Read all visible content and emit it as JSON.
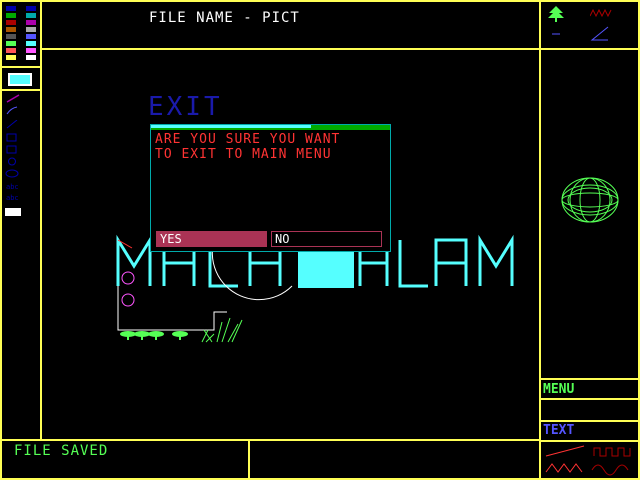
{
  "header": {
    "title": "FILE NAME - PICT"
  },
  "status": {
    "message": "FILE SAVED"
  },
  "side": {
    "menu_label": "MENU",
    "text_label": "TEXT"
  },
  "dialog": {
    "title": "EXIT",
    "message_line1": " ARE YOU SURE YOU WANT",
    "message_line2": "TO EXIT TO MAIN MENU",
    "yes_label": "YES",
    "no_label": "NO"
  },
  "canvas": {
    "art_text": "MALH HLAM"
  },
  "colors": {
    "frame": "#ffff55",
    "selected_color": "#55ffff",
    "accent_green": "#55ff55"
  },
  "palette": [
    "#0000aa",
    "#00aa00",
    "#00aaaa",
    "#aa0000",
    "#aa00aa",
    "#aa5500",
    "#aaaaaa",
    "#555555",
    "#5555ff",
    "#55ff55",
    "#55ffff",
    "#ff5555",
    "#ff55ff",
    "#ffff55",
    "#ffffff",
    "#000000"
  ],
  "tools": [
    "pencil-icon",
    "brush-icon",
    "line-icon",
    "rectangle-icon",
    "circle-icon",
    "ellipse-icon",
    "spray-icon",
    "fill-icon"
  ]
}
